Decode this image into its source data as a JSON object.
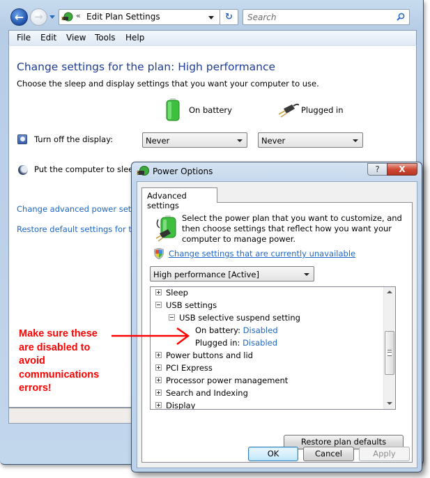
{
  "main_window": {
    "address": {
      "chevron": "«",
      "path": "Edit Plan Settings",
      "refresh_glyph": "↻"
    },
    "search": {
      "placeholder": "Search"
    },
    "menu": [
      "File",
      "Edit",
      "View",
      "Tools",
      "Help"
    ],
    "title": "Change settings for the plan: High performance",
    "subtitle": "Choose the sleep and display settings that you want your computer to use.",
    "columns": {
      "battery": "On battery",
      "plugged": "Plugged in"
    },
    "settings": [
      {
        "label": "Turn off the display:",
        "on_battery": "Never",
        "plugged_in": "Never"
      },
      {
        "label": "Put the computer to sleep:"
      }
    ],
    "links": {
      "advanced": "Change advanced power settings",
      "restore": "Restore default settings for this plan"
    }
  },
  "annotation": {
    "text": "Make sure these are disabled to avoid communications errors!",
    "lines": [
      "Make sure these",
      "are disabled to",
      "avoid",
      "communications",
      "errors!"
    ],
    "color": "#ff0000"
  },
  "dialog": {
    "title": "Power Options",
    "help_glyph": "?",
    "close_glyph": "X",
    "tab": "Advanced settings",
    "intro": "Select the power plan that you want to customize, and then choose settings that reflect how you want your computer to manage power.",
    "unavailable_link": "Change settings that are currently unavailable",
    "plan_select": "High performance [Active]",
    "tree": [
      {
        "label": "Sleep",
        "level": 0,
        "expander": "plus"
      },
      {
        "label": "USB settings",
        "level": 0,
        "expander": "minus"
      },
      {
        "label": "USB selective suspend setting",
        "level": 1,
        "expander": "minus"
      },
      {
        "label": "On battery:",
        "value": "Disabled",
        "level": 2
      },
      {
        "label": "Plugged in:",
        "value": "Disabled",
        "level": 2
      },
      {
        "label": "Power buttons and lid",
        "level": 0,
        "expander": "plus"
      },
      {
        "label": "PCI Express",
        "level": 0,
        "expander": "plus"
      },
      {
        "label": "Processor power management",
        "level": 0,
        "expander": "plus"
      },
      {
        "label": "Search and Indexing",
        "level": 0,
        "expander": "plus"
      },
      {
        "label": "Display",
        "level": 0,
        "expander": "plus"
      }
    ],
    "buttons": {
      "restore": "Restore plan defaults",
      "ok": "OK",
      "cancel": "Cancel",
      "apply": "Apply"
    }
  }
}
